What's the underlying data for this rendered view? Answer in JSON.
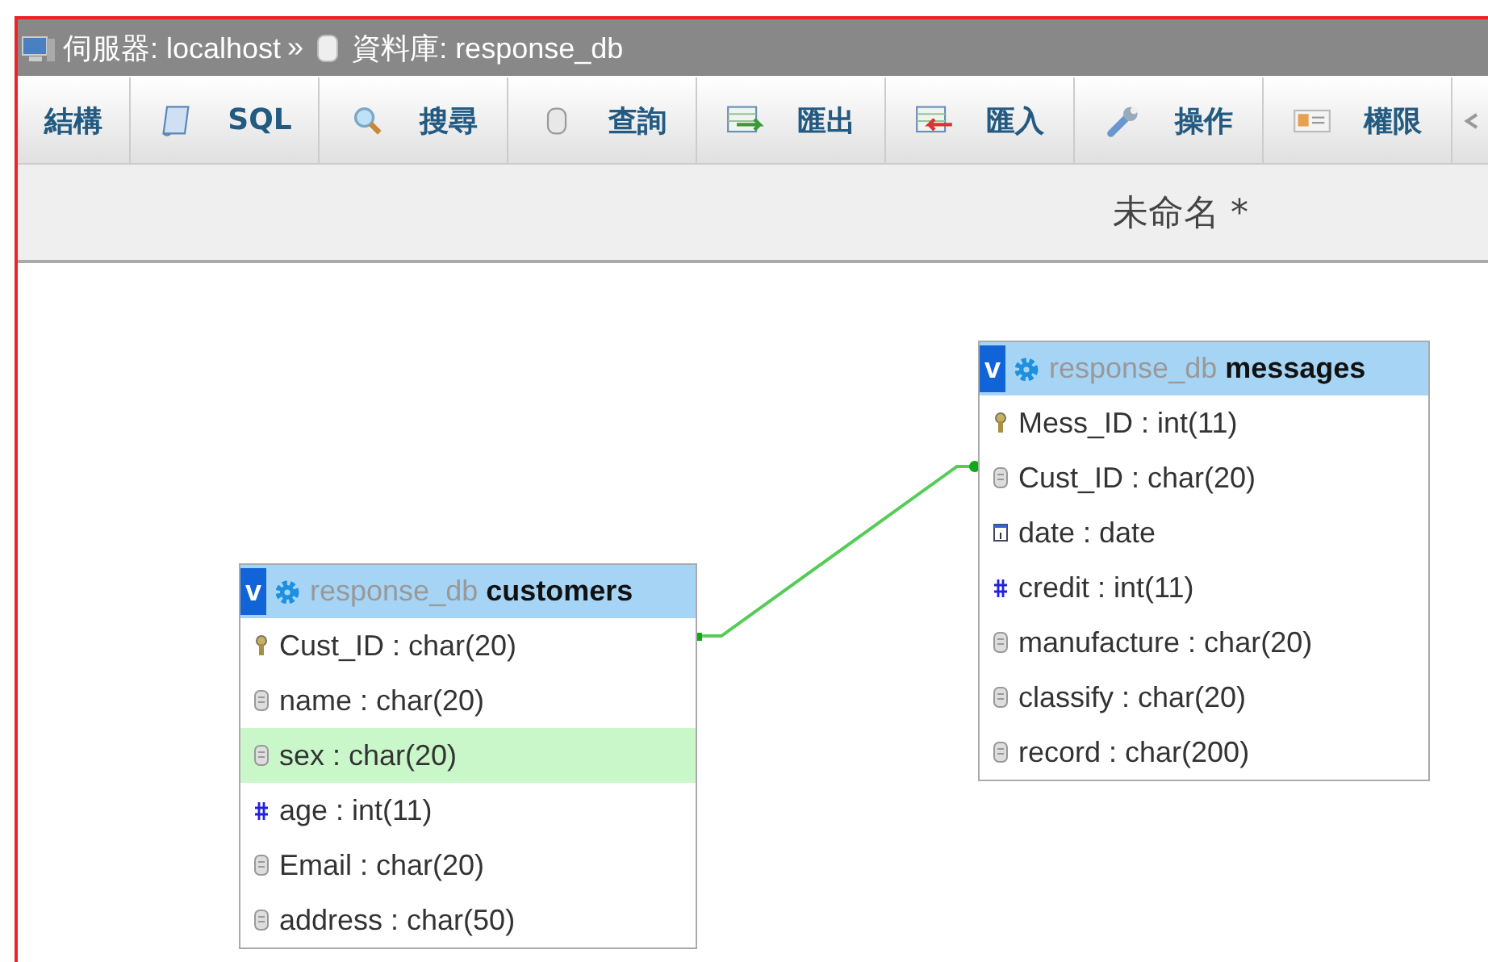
{
  "breadcrumb": {
    "server_label": "伺服器: localhost",
    "separator": "»",
    "database_label": "資料庫: response_db"
  },
  "tabs": [
    {
      "label": "結構",
      "kind": "none"
    },
    {
      "label": "SQL",
      "kind": "sql"
    },
    {
      "label": "搜尋",
      "kind": "search"
    },
    {
      "label": "查詢",
      "kind": "query"
    },
    {
      "label": "匯出",
      "kind": "export"
    },
    {
      "label": "匯入",
      "kind": "import"
    },
    {
      "label": "操作",
      "kind": "wrench"
    },
    {
      "label": "權限",
      "kind": "card"
    },
    {
      "kind": "cut"
    }
  ],
  "designer": {
    "title": "未命名 *",
    "tables": [
      {
        "toggle": "v",
        "database": "response_db",
        "name": "customers",
        "fields": [
          {
            "text": "Cust_ID : char(20)",
            "kind": "key",
            "highlighted": false
          },
          {
            "text": "name : char(20)",
            "kind": "text",
            "highlighted": false
          },
          {
            "text": "sex : char(20)",
            "kind": "text",
            "highlighted": true
          },
          {
            "text": "age : int(11)",
            "kind": "number",
            "highlighted": false
          },
          {
            "text": "Email : char(20)",
            "kind": "text",
            "highlighted": false
          },
          {
            "text": "address : char(50)",
            "kind": "text",
            "highlighted": false
          }
        ]
      },
      {
        "toggle": "v",
        "database": "response_db",
        "name": "messages",
        "fields": [
          {
            "text": "Mess_ID : int(11)",
            "kind": "key",
            "highlighted": false
          },
          {
            "text": "Cust_ID : char(20)",
            "kind": "text",
            "highlighted": false
          },
          {
            "text": "date : date",
            "kind": "date",
            "highlighted": false
          },
          {
            "text": "credit : int(11)",
            "kind": "number",
            "highlighted": false
          },
          {
            "text": "manufacture : char(20)",
            "kind": "text",
            "highlighted": false
          },
          {
            "text": "classify : char(20)",
            "kind": "text",
            "highlighted": false
          },
          {
            "text": "record : char(200)",
            "kind": "text",
            "highlighted": false
          }
        ]
      }
    ]
  }
}
